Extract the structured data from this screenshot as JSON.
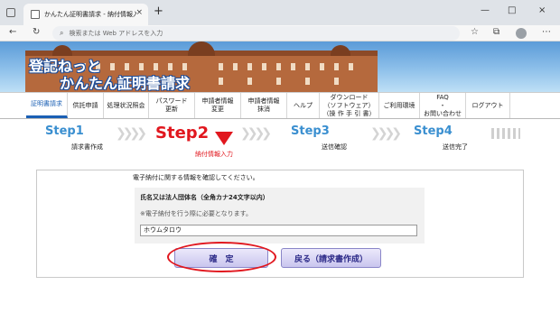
{
  "browser": {
    "tab_title": "かんたん証明書請求 - 納付情報入",
    "tab_close": "×",
    "new_tab": "+",
    "back": "←",
    "reload": "↻",
    "search_icon": "⌕",
    "address_placeholder": "検索または Web アドレスを入力",
    "window_min": "—",
    "window_max": "□",
    "window_close": "×",
    "menu_dots": "⋯"
  },
  "header": {
    "logo_line1": "登記ねっと",
    "logo_line2": "かんたん証明書請求"
  },
  "menu": [
    {
      "label": "証明書請求",
      "active": true
    },
    {
      "label": "供託申請",
      "active": false
    },
    {
      "label": "処理状況照会",
      "active": false
    },
    {
      "label": "パスワード\n更新",
      "active": false
    },
    {
      "label": "申請者情報\n変更",
      "active": false
    },
    {
      "label": "申請者情報\n抹消",
      "active": false
    },
    {
      "label": "ヘルプ",
      "active": false
    },
    {
      "label": "ダウンロード\n（ソフトウェア）\n（操 作 手 引 書）",
      "active": false
    },
    {
      "label": "ご利用環境",
      "active": false
    },
    {
      "label": "FAQ\n・\nお問い合わせ",
      "active": false
    },
    {
      "label": "ログアウト",
      "active": false
    }
  ],
  "steps": [
    {
      "title": "Step1",
      "label": "請求書作成",
      "current": false
    },
    {
      "title": "Step2",
      "label": "納付情報入力",
      "current": true
    },
    {
      "title": "Step3",
      "label": "送信確認",
      "current": false
    },
    {
      "title": "Step4",
      "label": "送信完了",
      "current": false
    }
  ],
  "chevrons": "❯❯❯❯",
  "form": {
    "intro": "電子納付に関する情報を確認してください。",
    "field_label": "氏名又は法人団体名（全角カナ24文字以内）",
    "field_note": "※電子納付を行う際に必要となります。",
    "field_value": "ホウムタロウ",
    "confirm_button": "確　定",
    "back_button": "戻る（請求書作成）"
  },
  "colors": {
    "step_blue": "#3a8fd0",
    "step_current": "#e1171e",
    "annotation_ring": "#e1171e",
    "button_text": "#2c2a88"
  }
}
